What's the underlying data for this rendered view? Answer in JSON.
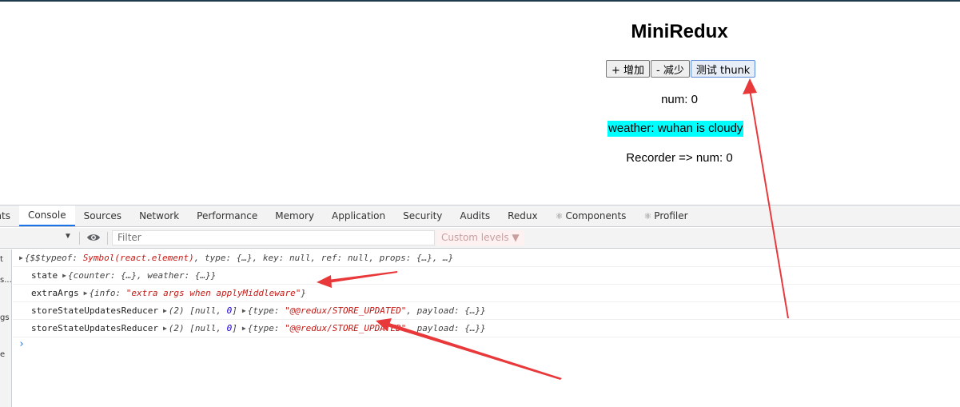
{
  "app": {
    "title": "MiniRedux",
    "buttons": [
      "+ 增加",
      "- 减少",
      "测试 thunk"
    ],
    "num_text": "num: 0",
    "weather_text": "weather: wuhan is cloudy",
    "recorder_text": "Recorder => num: 0"
  },
  "devtools": {
    "tabs": [
      {
        "label": "ents",
        "icon": ""
      },
      {
        "label": "Console",
        "icon": ""
      },
      {
        "label": "Sources",
        "icon": ""
      },
      {
        "label": "Network",
        "icon": ""
      },
      {
        "label": "Performance",
        "icon": ""
      },
      {
        "label": "Memory",
        "icon": ""
      },
      {
        "label": "Application",
        "icon": ""
      },
      {
        "label": "Security",
        "icon": ""
      },
      {
        "label": "Audits",
        "icon": ""
      },
      {
        "label": "Redux",
        "icon": ""
      },
      {
        "label": "Components",
        "icon": "⚛"
      },
      {
        "label": "Profiler",
        "icon": "⚛"
      }
    ],
    "active_tab": "Console",
    "filter_placeholder": "Filter",
    "levels_label": "Custom levels ▼",
    "sidebar_fragments": [
      "t",
      "s...",
      "gs",
      "e"
    ],
    "console": {
      "line1": {
        "p1": "{$$typeof: ",
        "sym": "Symbol(react.element)",
        "p2": ", type: {…}, key: ",
        "null1": "null",
        "p3": ", ref: ",
        "null2": "null",
        "p4": ", props: {…}, …}"
      },
      "line2": {
        "label": "state",
        "obj": "{counter: {…}, weather: {…}}"
      },
      "line3": {
        "label": "extraArgs",
        "p1": "{info: ",
        "str": "\"extra args when applyMiddleware\"",
        "p2": "}"
      },
      "line4": {
        "label": "storeStateUpdatesReducer",
        "arr_p1": "(2) [",
        "arr_null": "null",
        "arr_sep": ", ",
        "arr_zero": "0",
        "arr_p2": "]",
        "obj_p1": "{type: ",
        "obj_str": "\"@@redux/STORE_UPDATED\"",
        "obj_p2": ", payload: {…}}"
      },
      "line5": {
        "label": "storeStateUpdatesReducer",
        "arr_p1": "(2) [",
        "arr_null": "null",
        "arr_sep": ", ",
        "arr_zero": "0",
        "arr_p2": "]",
        "obj_p1": "{type: ",
        "obj_str": "\"@@redux/STORE_UPDATED\"",
        "obj_p2": ", payload: {…}}"
      },
      "prompt": "›"
    }
  },
  "colors": {
    "weather_bg": "#00ffff",
    "arrow": "#e8383a",
    "active_tab_underline": "#1a73e8",
    "string_red": "#c41a16",
    "number_blue": "#1c00cf"
  }
}
